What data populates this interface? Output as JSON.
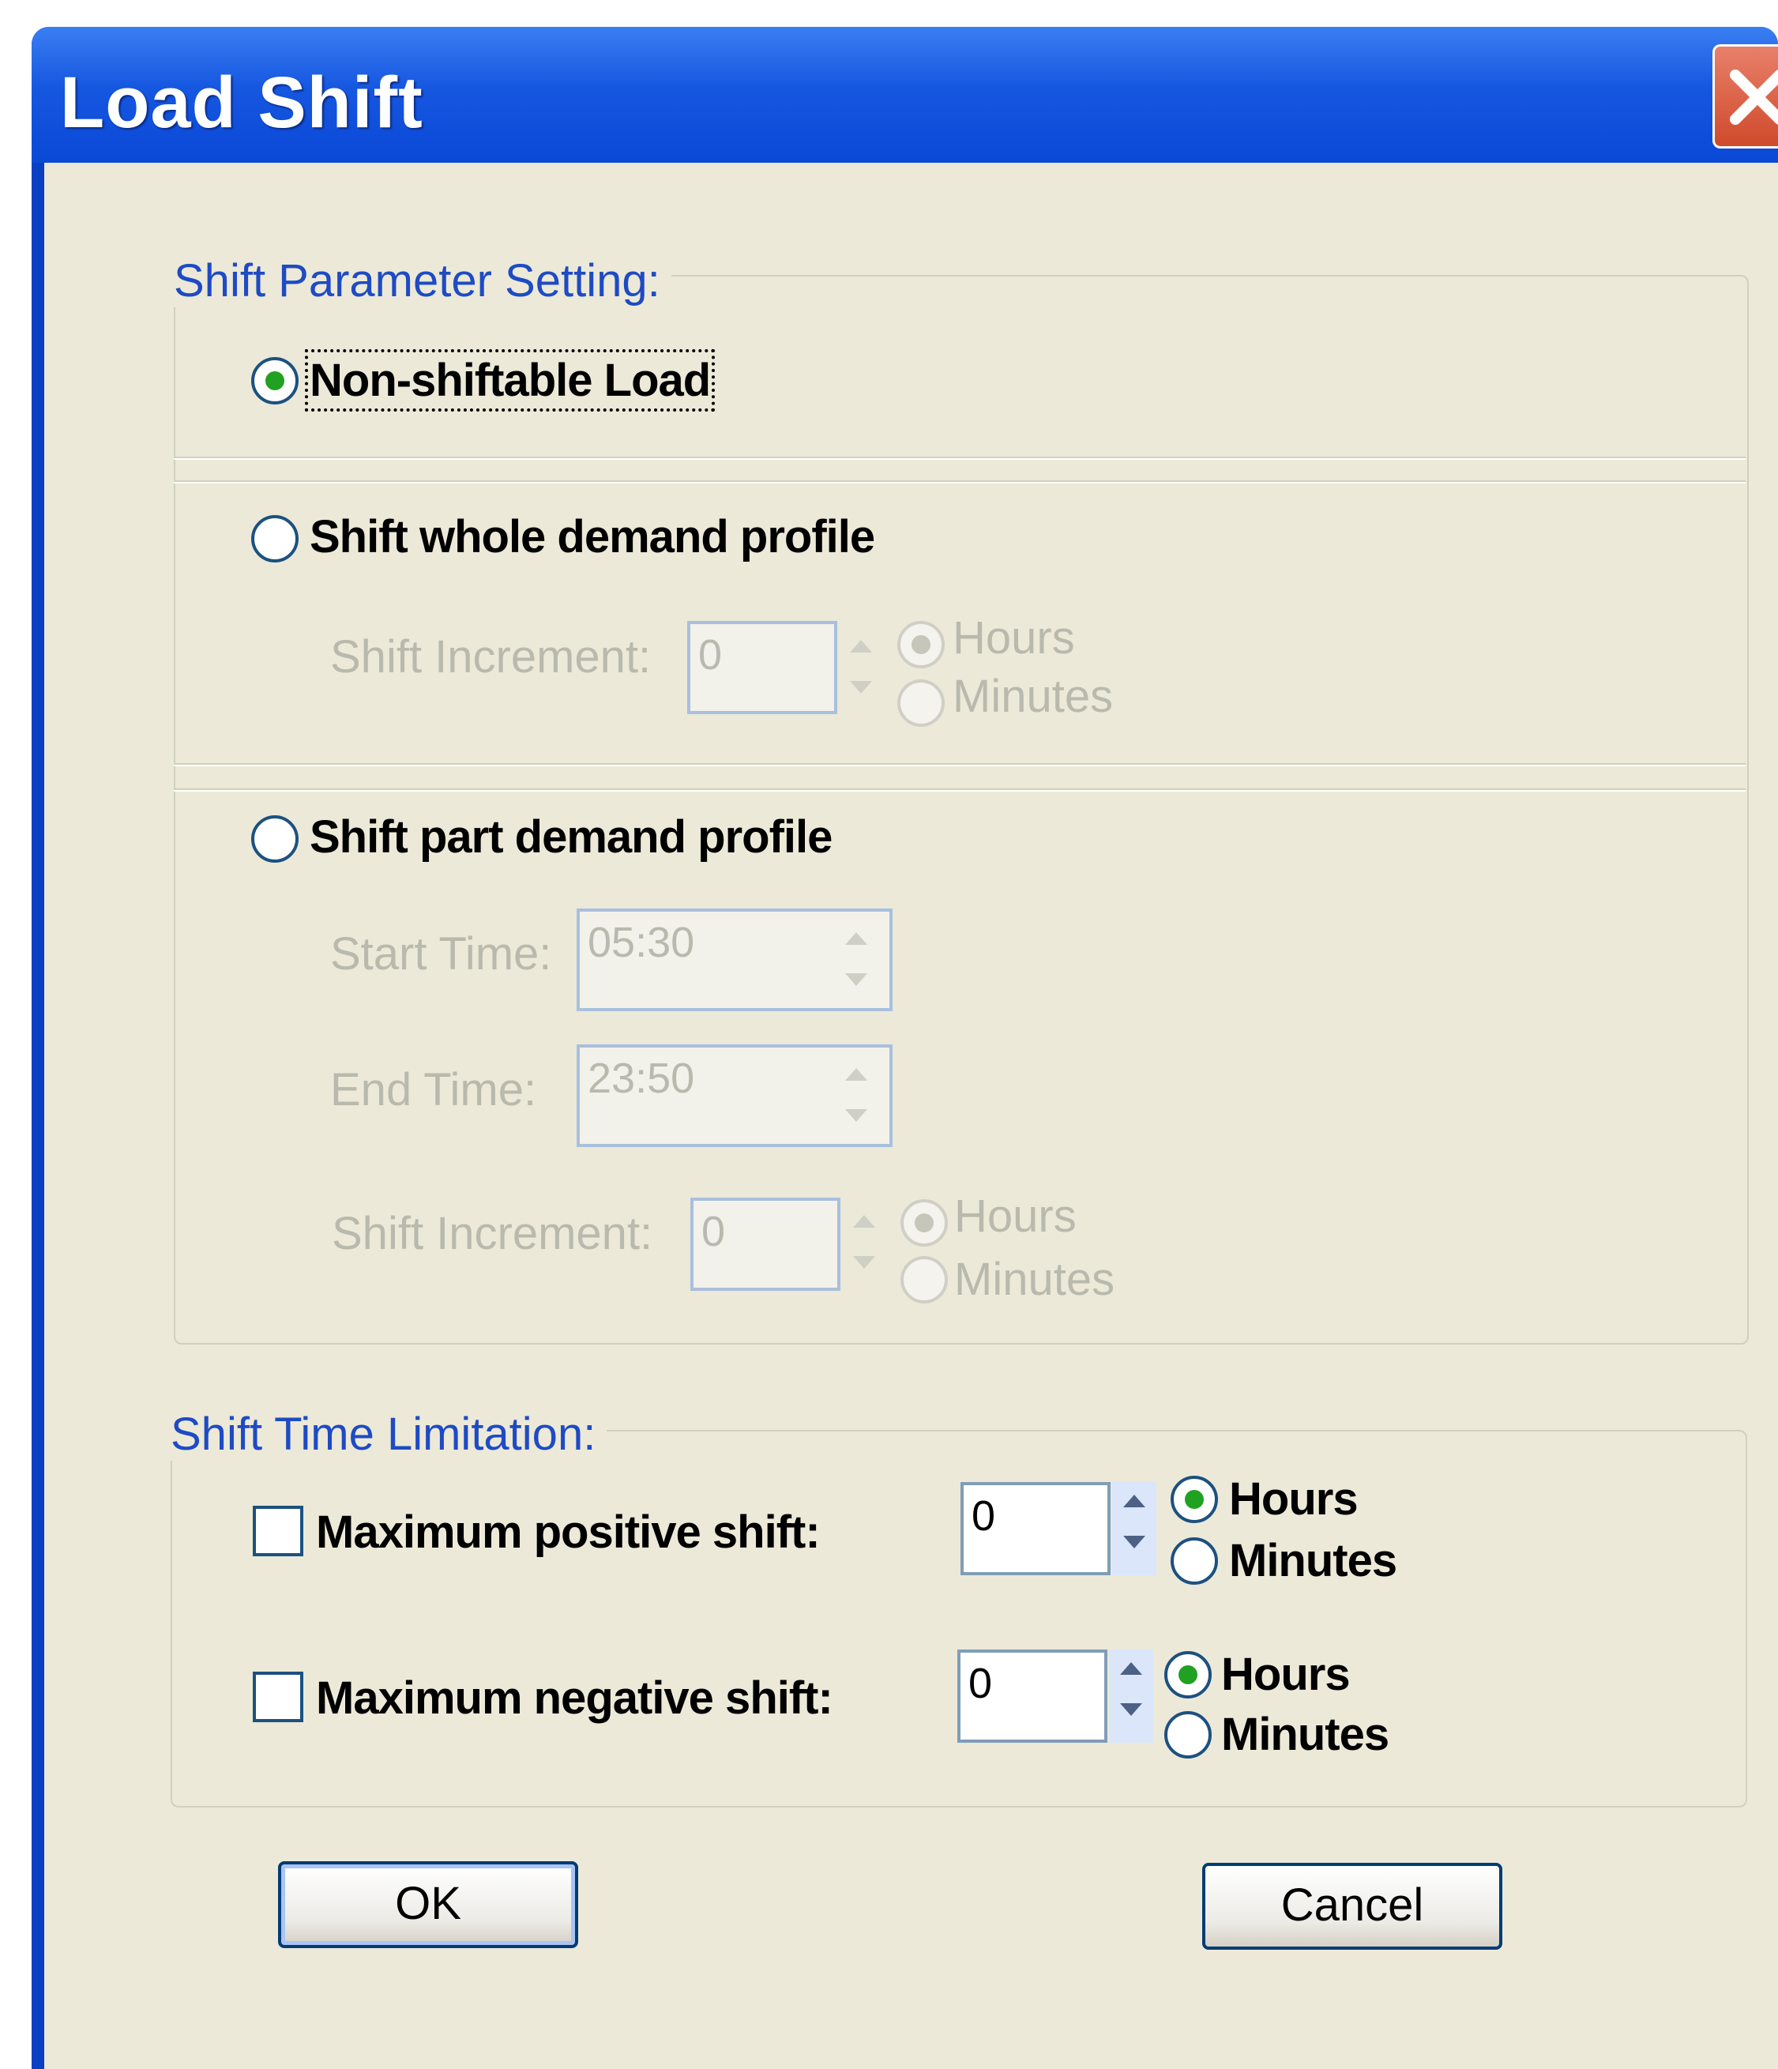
{
  "window": {
    "title": "Load Shift"
  },
  "shift_parameter": {
    "title": "Shift Parameter Setting:",
    "non_shiftable": {
      "label": "Non-shiftable Load",
      "selected": true
    },
    "whole": {
      "label": "Shift whole demand profile",
      "selected": false,
      "increment_label": "Shift Increment:",
      "increment_value": "0",
      "hours": "Hours",
      "minutes": "Minutes"
    },
    "part": {
      "label": "Shift part demand profile",
      "selected": false,
      "start_label": "Start Time:",
      "start_value": "05:30",
      "end_label": "End Time:",
      "end_value": "23:50",
      "increment_label": "Shift Increment:",
      "increment_value": "0",
      "hours": "Hours",
      "minutes": "Minutes"
    }
  },
  "time_limitation": {
    "title": "Shift Time Limitation:",
    "positive": {
      "label": "Maximum positive shift:",
      "checked": false,
      "value": "0",
      "hours": "Hours",
      "minutes": "Minutes"
    },
    "negative": {
      "label": "Maximum negative shift:",
      "checked": false,
      "value": "0",
      "hours": "Hours",
      "minutes": "Minutes"
    }
  },
  "buttons": {
    "ok": "OK",
    "cancel": "Cancel"
  },
  "colors": {
    "titlebar": "#0a48d6",
    "group_title": "#1e4bc4",
    "dialog_bg": "#ece9d8",
    "close": "#d04a2c"
  }
}
